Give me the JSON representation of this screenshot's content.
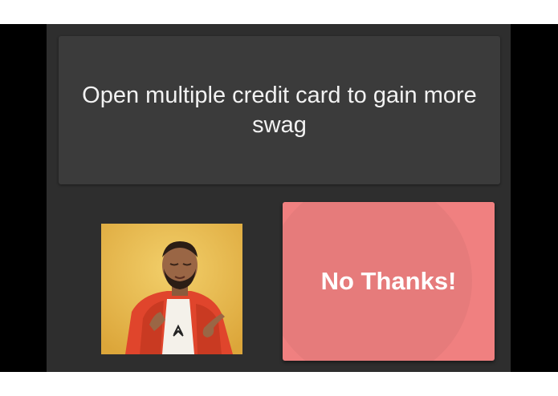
{
  "prompt": {
    "text": "Open multiple credit card to gain more swag"
  },
  "meme": {
    "image": "drake-approving-photo"
  },
  "action": {
    "label": "No Thanks!"
  },
  "colors": {
    "app_background": "#2e2e2e",
    "card_background": "#3b3b3b",
    "button_background": "#f08080",
    "text": "#f2f2f2"
  }
}
